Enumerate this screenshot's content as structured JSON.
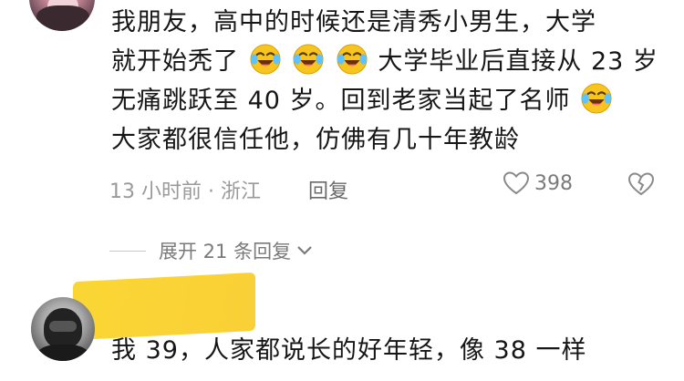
{
  "comment1": {
    "line1": "我朋友，高中的时候还是清秀小男生，大学",
    "line2_prefix": "就开始秃了",
    "line2_suffix": "大学毕业后直接从 23 岁",
    "line3_prefix": "无痛跳跃至 40 岁。回到老家当起了名师",
    "line4": "大家都很信任他，仿佛有几十年教龄",
    "time_location": "13 小时前 · 浙江",
    "reply_label": "回复",
    "like_count": "398",
    "emoji": "face-with-tears-of-joy"
  },
  "expand": {
    "label": "展开 21 条回复"
  },
  "comment2": {
    "text": "我 39，人家都说长的好年轻，像 38 一样"
  }
}
